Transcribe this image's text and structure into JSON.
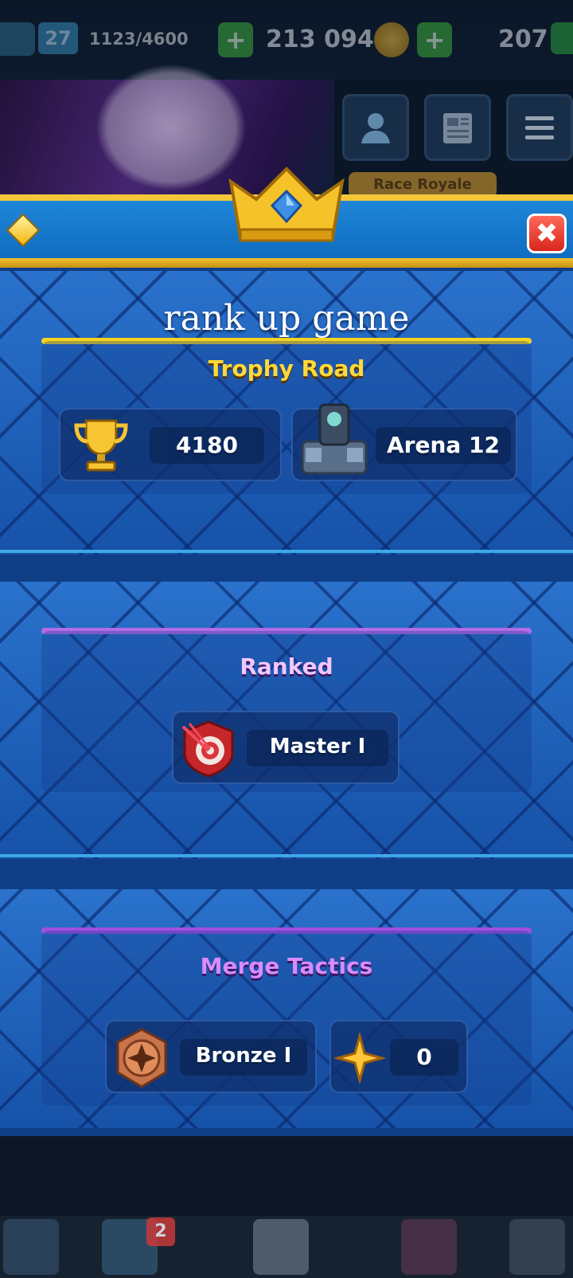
{
  "status_bar": {
    "level": "27",
    "xp": "1123/4600",
    "gold": "213 094",
    "gems": "207"
  },
  "background": {
    "race_tag": "Race Royale"
  },
  "popup": {
    "title": "rank up game",
    "close_symbol": "✖",
    "trophy_road": {
      "title": "Trophy Road",
      "trophies": "4180",
      "arena": "Arena 12"
    },
    "ranked": {
      "title": "Ranked",
      "league": "Master I"
    },
    "merge_tactics": {
      "title": "Merge Tactics",
      "league": "Bronze I",
      "stars": "0"
    }
  },
  "bottom_nav": {
    "badge_count": "2"
  },
  "colors": {
    "accent_gold": "#f6d31e",
    "accent_purple": "#b36be6",
    "panel_blue": "#1b5db5",
    "close_red": "#d8261c"
  },
  "icons": [
    "level-icon",
    "plus-icon",
    "gold-coin-icon",
    "gem-icon",
    "friends-icon",
    "news-icon",
    "menu-icon",
    "crown-icon",
    "diamond-icon",
    "close-icon",
    "trophy-icon",
    "arena-icon",
    "ranked-target-icon",
    "bronze-badge-icon",
    "star-icon"
  ]
}
